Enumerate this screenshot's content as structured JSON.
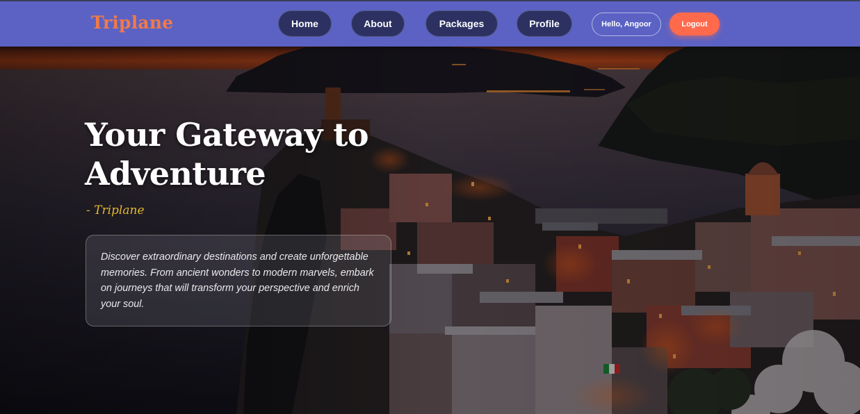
{
  "brand": {
    "name": "Triplane"
  },
  "nav": {
    "home": "Home",
    "about": "About",
    "packages": "Packages",
    "profile": "Profile"
  },
  "user": {
    "greeting": "Hello, Angoor",
    "logout": "Logout"
  },
  "hero": {
    "title": "Your Gateway to Adventure",
    "subtitle": "- Triplane",
    "description": "Discover extraordinary destinations and create unforgettable memories. From ancient wonders to modern marvels, embark on journeys that will transform your perspective and enrich your soul.",
    "background": "coastal-village-night-photo"
  },
  "colors": {
    "navbar": "#5b62c4",
    "brand": "#f27a45",
    "nav_button": "#2c3162",
    "logout": "#ff6a4d",
    "subtitle": "#e2b82f"
  }
}
